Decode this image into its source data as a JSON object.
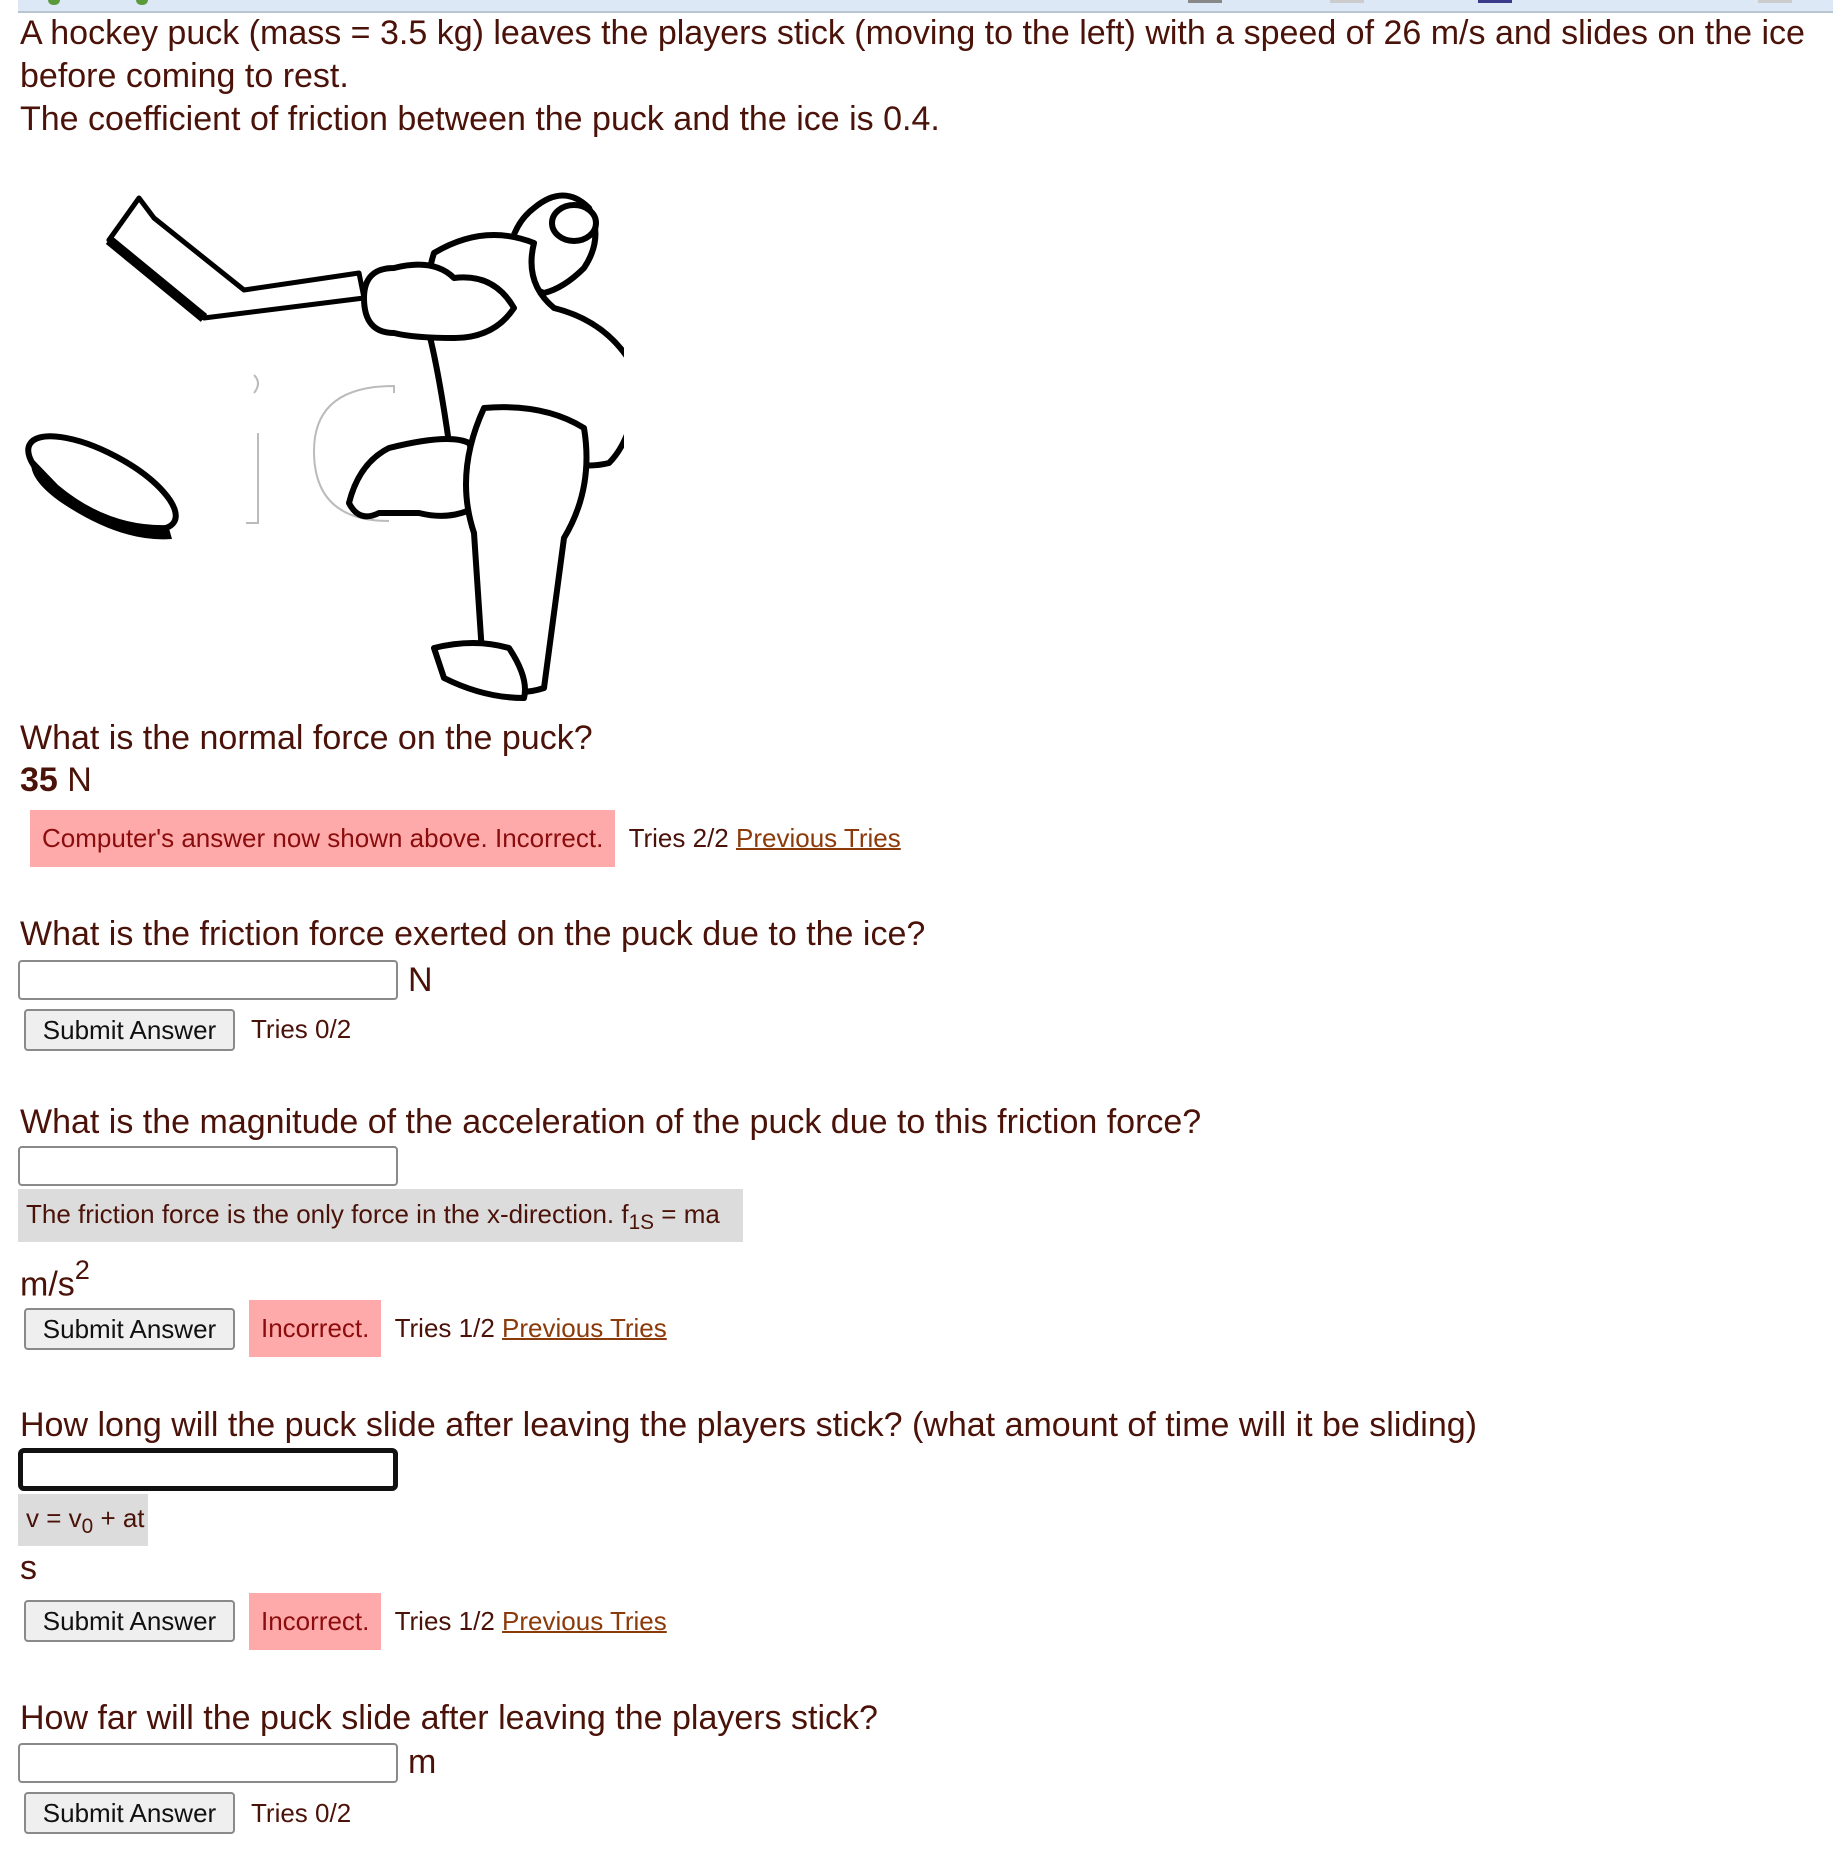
{
  "intro": {
    "line1": "A hockey puck (mass = 3.5 kg) leaves the players stick (moving to the left) with a speed of 26 m/s and slides on the ice before coming to rest.",
    "line2": "The coefficient of friction between the puck and the ice is 0.4."
  },
  "figure": {
    "description": "Hockey player slapshot illustration with puck",
    "watermark": "ic"
  },
  "colors": {
    "text": "#4a1208",
    "incorrect_bg": "#ffaaaa",
    "incorrect_text": "#8b0c0c",
    "hint_bg": "#dcdcdc",
    "link": "#8b3a0a"
  },
  "questions": [
    {
      "prompt": "What is the normal force on the puck?",
      "answer_value": "35",
      "unit": "N",
      "feedback": "Computer's answer now shown above. Incorrect.",
      "tries": "Tries 2/2",
      "previous_tries": "Previous Tries"
    },
    {
      "prompt": "What is the friction force exerted on the puck due to the ice?",
      "input_value": "",
      "unit": "N",
      "submit": "Submit Answer",
      "tries": "Tries 0/2"
    },
    {
      "prompt": "What is the magnitude of the acceleration of the puck due to this friction force?",
      "input_value": "",
      "hint_text": "The friction force is the only force in the x-direction. f",
      "hint_sub": "1S",
      "hint_tail": " = ma",
      "unit_base": "m/s",
      "unit_sup": "2",
      "submit": "Submit Answer",
      "feedback": "Incorrect.",
      "tries": "Tries 1/2",
      "previous_tries": "Previous Tries"
    },
    {
      "prompt": "How long will the puck slide after leaving the players stick? (what amount of time will it be sliding)",
      "input_value": "",
      "hint_text": "v = v",
      "hint_sub": "0",
      "hint_tail": " + at",
      "unit": "s",
      "submit": "Submit Answer",
      "feedback": "Incorrect.",
      "tries": "Tries 1/2",
      "previous_tries": "Previous Tries"
    },
    {
      "prompt": "How far will the puck slide after leaving the players stick?",
      "input_value": "",
      "unit": "m",
      "submit": "Submit Answer",
      "tries": "Tries 0/2"
    }
  ]
}
